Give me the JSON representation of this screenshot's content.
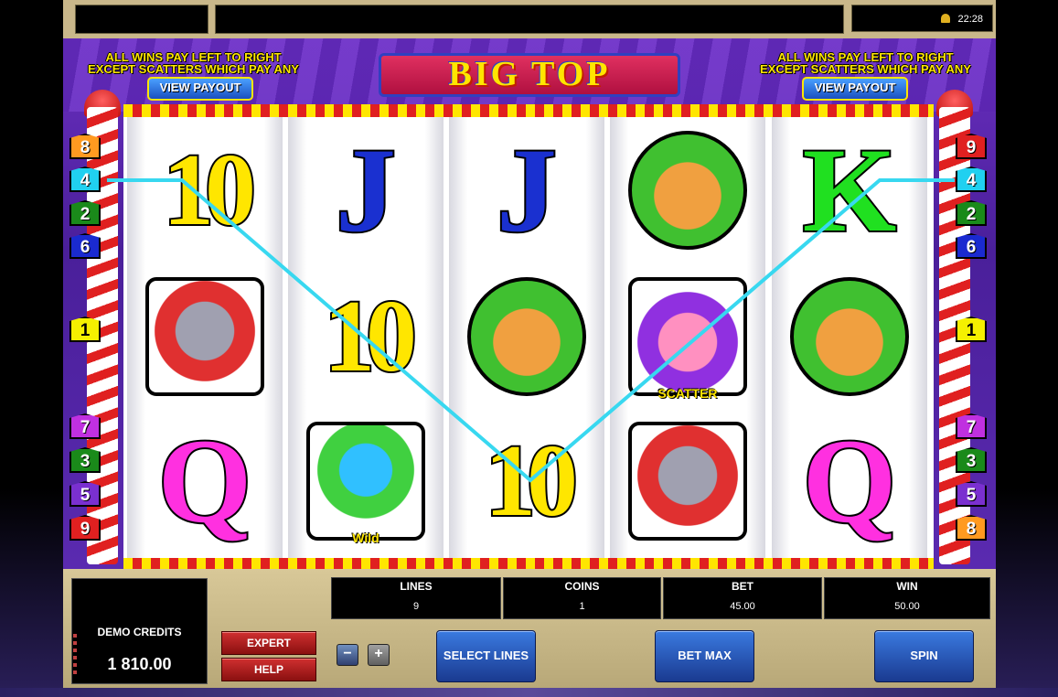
{
  "top_bar": {
    "clock": "22:28"
  },
  "header": {
    "info_left_line1": "ALL WINS PAY LEFT TO RIGHT",
    "info_left_line2": "EXCEPT SCATTERS WHICH PAY ANY",
    "info_right_line1": "ALL WINS PAY LEFT TO RIGHT",
    "info_right_line2": "EXCEPT SCATTERS WHICH PAY ANY",
    "view_payout_left": "VIEW PAYOUT",
    "view_payout_right": "VIEW PAYOUT",
    "logo": "BIG TOP"
  },
  "reels": [
    [
      "10",
      "elephant",
      "Q"
    ],
    [
      "J",
      "10",
      "wild"
    ],
    [
      "J",
      "lion",
      "10"
    ],
    [
      "lion",
      "scatter",
      "elephant"
    ],
    [
      "K",
      "lion",
      "Q"
    ]
  ],
  "symbol_labels": {
    "scatter": "SCATTER",
    "wild": "Wild"
  },
  "line_markers": {
    "left": [
      "8",
      "4",
      "2",
      "6",
      "1",
      "7",
      "3",
      "5",
      "9"
    ],
    "right": [
      "9",
      "4",
      "2",
      "6",
      "1",
      "7",
      "3",
      "5",
      "8"
    ]
  },
  "line_marker_colors": {
    "1": "#f5f000",
    "2": "#1a8a1a",
    "3": "#1a8a1a",
    "4": "#20d0f0",
    "5": "#7a30d0",
    "6": "#1a2ad0",
    "7": "#c030e0",
    "8": "#ff9a20",
    "9": "#e02020"
  },
  "winning_line": {
    "number": "4",
    "color": "#38d8f0"
  },
  "console": {
    "demo_credits_label": "DEMO CREDITS",
    "demo_credits_value": "1 810.00",
    "expert_label": "EXPERT",
    "help_label": "HELP",
    "minus_label": "−",
    "plus_label": "+",
    "select_lines_label": "SELECT LINES",
    "bet_max_label": "BET MAX",
    "spin_label": "SPIN",
    "stats": {
      "lines_label": "LINES",
      "lines_value": "9",
      "coins_label": "COINS",
      "coins_value": "1",
      "bet_label": "BET",
      "bet_value": "45.00",
      "win_label": "WIN",
      "win_value": "50.00"
    }
  }
}
